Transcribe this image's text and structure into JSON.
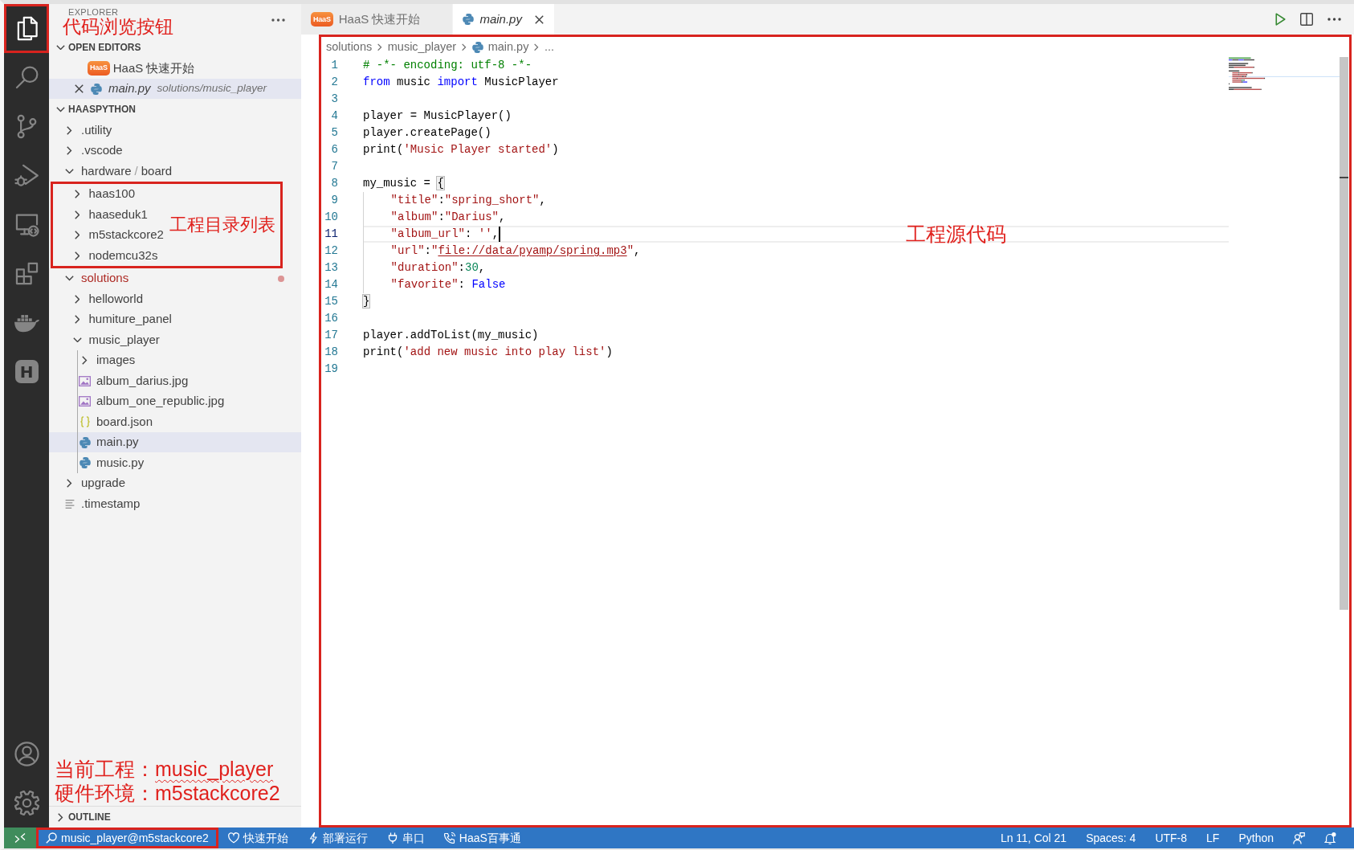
{
  "activity_bar": {
    "items": [
      {
        "kind": "explorer",
        "selected": true,
        "outlined": true
      },
      {
        "kind": "search",
        "selected": false,
        "outlined": false
      },
      {
        "kind": "source_control",
        "selected": false,
        "outlined": false
      },
      {
        "kind": "run_debug",
        "selected": false,
        "outlined": false
      },
      {
        "kind": "remote_explorer",
        "selected": false,
        "outlined": false
      },
      {
        "kind": "extensions",
        "selected": false,
        "outlined": false
      },
      {
        "kind": "docker",
        "selected": false,
        "outlined": false
      },
      {
        "kind": "haas",
        "glyph": "H",
        "selected": false,
        "outlined": false
      }
    ],
    "bottom_items": [
      {
        "kind": "accounts"
      },
      {
        "kind": "settings"
      }
    ]
  },
  "sidebar": {
    "title": "EXPLORER",
    "annotation": "代码浏览按钮",
    "actions": [
      {
        "kind": "more"
      }
    ],
    "sections": [
      {
        "kind": "open_editors",
        "title": "OPEN EDITORS",
        "expanded": true,
        "items": [
          {
            "kind": "webview",
            "logo_text": "HaaS",
            "label": "HaaS 快速开始",
            "preview": false,
            "selected": false
          },
          {
            "kind": "python",
            "label": "main.py",
            "description": "solutions/music_player",
            "preview": true,
            "selected": true
          }
        ]
      },
      {
        "kind": "workspace",
        "title": "HAASPYTHON",
        "expanded": true,
        "tree": [
          {
            "kind": "folder",
            "label": ".utility",
            "expanded": false,
            "selected": false,
            "problem": false
          },
          {
            "kind": "folder",
            "label": ".vscode",
            "expanded": false,
            "selected": false,
            "problem": false
          },
          {
            "kind": "folder",
            "segments": [
              "hardware",
              "board"
            ],
            "separator": "/",
            "expanded": true,
            "selected": false,
            "problem": false,
            "children_outlined": true,
            "annotation": "工程目录列表",
            "children": [
              {
                "kind": "folder",
                "label": "haas100",
                "expanded": false,
                "selected": false,
                "problem": false
              },
              {
                "kind": "folder",
                "label": "haaseduk1",
                "expanded": false,
                "selected": false,
                "problem": false
              },
              {
                "kind": "folder",
                "label": "m5stackcore2",
                "expanded": false,
                "selected": false,
                "problem": false
              },
              {
                "kind": "folder",
                "label": "nodemcu32s",
                "expanded": false,
                "selected": false,
                "problem": false
              }
            ]
          },
          {
            "kind": "folder",
            "label": "solutions",
            "expanded": true,
            "selected": false,
            "problem": true,
            "children_outlined": false,
            "children": [
              {
                "kind": "folder",
                "label": "helloworld",
                "expanded": false,
                "selected": false,
                "problem": false
              },
              {
                "kind": "folder",
                "label": "humiture_panel",
                "expanded": false,
                "selected": false,
                "problem": false
              },
              {
                "kind": "folder",
                "label": "music_player",
                "expanded": true,
                "selected": false,
                "problem": false,
                "children_outlined": false,
                "children": [
                  {
                    "kind": "folder",
                    "label": "images",
                    "expanded": false,
                    "selected": false,
                    "problem": false
                  },
                  {
                    "kind": "image",
                    "label": "album_darius.jpg",
                    "selected": false,
                    "problem": false
                  },
                  {
                    "kind": "image",
                    "label": "album_one_republic.jpg",
                    "selected": false,
                    "problem": false
                  },
                  {
                    "kind": "json",
                    "label": "board.json",
                    "selected": false,
                    "problem": false
                  },
                  {
                    "kind": "python",
                    "label": "main.py",
                    "selected": true,
                    "problem": false
                  },
                  {
                    "kind": "python",
                    "label": "music.py",
                    "selected": false,
                    "problem": false
                  }
                ]
              }
            ]
          },
          {
            "kind": "folder",
            "label": "upgrade",
            "expanded": false,
            "selected": false,
            "problem": false
          },
          {
            "kind": "text",
            "label": ".timestamp",
            "selected": false,
            "problem": false
          }
        ]
      }
    ],
    "notes": [
      {
        "label": "当前工程：",
        "value": "music_player",
        "squiggle": true
      },
      {
        "label": "硬件环境：",
        "value": "m5stackcore2",
        "squiggle": false
      }
    ],
    "bottom_sections": [
      {
        "kind": "outline",
        "title": "OUTLINE",
        "expanded": false
      }
    ]
  },
  "tabs": [
    {
      "kind": "webview",
      "logo_text": "HaaS",
      "label": "HaaS 快速开始",
      "preview": false,
      "selected": false
    },
    {
      "kind": "python",
      "label": "main.py",
      "preview": true,
      "selected": true
    }
  ],
  "editor_actions": [
    {
      "kind": "run"
    },
    {
      "kind": "split"
    },
    {
      "kind": "more"
    }
  ],
  "editor": {
    "outlined": true,
    "annotation": "工程源代码",
    "breadcrumbs": [
      {
        "kind": "folder",
        "label": "solutions"
      },
      {
        "kind": "folder",
        "label": "music_player"
      },
      {
        "kind": "python",
        "label": "main.py"
      },
      {
        "kind": "symbol",
        "label": "..."
      }
    ],
    "lines": [
      {
        "number": "1",
        "current": false,
        "indented": false,
        "tokens": [
          {
            "kind": "comment",
            "text": "# -*- encoding: utf-8 -*-"
          }
        ]
      },
      {
        "number": "2",
        "current": false,
        "indented": false,
        "tokens": [
          {
            "kind": "keyword",
            "text": "from"
          },
          {
            "kind": "plain",
            "text": " music "
          },
          {
            "kind": "keyword",
            "text": "import"
          },
          {
            "kind": "plain",
            "text": " MusicPlayer"
          }
        ]
      },
      {
        "number": "3",
        "current": false,
        "indented": false
      },
      {
        "number": "4",
        "current": false,
        "indented": false,
        "tokens": [
          {
            "kind": "plain",
            "text": "player = MusicPlayer()"
          }
        ]
      },
      {
        "number": "5",
        "current": false,
        "indented": false,
        "tokens": [
          {
            "kind": "plain",
            "text": "player.createPage()"
          }
        ]
      },
      {
        "number": "6",
        "current": false,
        "indented": false,
        "tokens": [
          {
            "kind": "plain",
            "text": "print("
          },
          {
            "kind": "string",
            "text": "'Music Player started'"
          },
          {
            "kind": "plain",
            "text": ")"
          }
        ]
      },
      {
        "number": "7",
        "current": false,
        "indented": false
      },
      {
        "number": "8",
        "current": false,
        "indented": false,
        "tokens": [
          {
            "kind": "plain",
            "text": "my_music = "
          },
          {
            "kind": "bracket",
            "text": "{"
          }
        ]
      },
      {
        "number": "9",
        "current": false,
        "indented": true,
        "tokens": [
          {
            "kind": "string",
            "text": "\"title\""
          },
          {
            "kind": "plain",
            "text": ":"
          },
          {
            "kind": "string",
            "text": "\"spring_short\""
          },
          {
            "kind": "plain",
            "text": ","
          }
        ]
      },
      {
        "number": "10",
        "current": false,
        "indented": true,
        "tokens": [
          {
            "kind": "string",
            "text": "\"album\""
          },
          {
            "kind": "plain",
            "text": ":"
          },
          {
            "kind": "string",
            "text": "\"Darius\""
          },
          {
            "kind": "plain",
            "text": ","
          }
        ]
      },
      {
        "number": "11",
        "current": true,
        "indented": true,
        "tokens": [
          {
            "kind": "string",
            "text": "\"album_url\""
          },
          {
            "kind": "plain",
            "text": ": "
          },
          {
            "kind": "string",
            "text": "''"
          },
          {
            "kind": "plain",
            "text": ","
          }
        ]
      },
      {
        "number": "12",
        "current": false,
        "indented": true,
        "tokens": [
          {
            "kind": "string",
            "text": "\"url\""
          },
          {
            "kind": "plain",
            "text": ":"
          },
          {
            "kind": "string",
            "text": "\""
          },
          {
            "kind": "link",
            "text": "file://data/pyamp/spring.mp3"
          },
          {
            "kind": "string",
            "text": "\""
          },
          {
            "kind": "plain",
            "text": ","
          }
        ]
      },
      {
        "number": "13",
        "current": false,
        "indented": true,
        "tokens": [
          {
            "kind": "string",
            "text": "\"duration\""
          },
          {
            "kind": "plain",
            "text": ":"
          },
          {
            "kind": "number",
            "text": "30"
          },
          {
            "kind": "plain",
            "text": ","
          }
        ]
      },
      {
        "number": "14",
        "current": false,
        "indented": true,
        "tokens": [
          {
            "kind": "string",
            "text": "\"favorite\""
          },
          {
            "kind": "plain",
            "text": ": "
          },
          {
            "kind": "keyword",
            "text": "False"
          }
        ]
      },
      {
        "number": "15",
        "current": false,
        "indented": false,
        "tokens": [
          {
            "kind": "bracket",
            "text": "}"
          }
        ]
      },
      {
        "number": "16",
        "current": false,
        "indented": false
      },
      {
        "number": "17",
        "current": false,
        "indented": false,
        "tokens": [
          {
            "kind": "plain",
            "text": "player.addToList(my_music)"
          }
        ]
      },
      {
        "number": "18",
        "current": false,
        "indented": false,
        "tokens": [
          {
            "kind": "plain",
            "text": "print("
          },
          {
            "kind": "string",
            "text": "'add new music into play list'"
          },
          {
            "kind": "plain",
            "text": ")"
          }
        ]
      },
      {
        "number": "19",
        "current": false,
        "indented": false
      }
    ]
  },
  "status_bar": {
    "left": [
      {
        "kind": "remote",
        "outlined": false
      },
      {
        "kind": "project",
        "label": "music_player@m5stackcore2",
        "outlined": true
      },
      {
        "kind": "quickstart",
        "label": "快速开始",
        "outlined": false
      },
      {
        "kind": "deploy",
        "label": "部署运行",
        "outlined": false
      },
      {
        "kind": "serial",
        "label": "串口",
        "outlined": false
      },
      {
        "kind": "assistant",
        "label": "HaaS百事通",
        "outlined": false
      }
    ],
    "right": [
      {
        "kind": "text",
        "label": "Ln 11, Col 21"
      },
      {
        "kind": "text",
        "label": "Spaces: 4"
      },
      {
        "kind": "text",
        "label": "UTF-8"
      },
      {
        "kind": "text",
        "label": "LF"
      },
      {
        "kind": "text",
        "label": "Python"
      },
      {
        "kind": "feedback"
      },
      {
        "kind": "notifications",
        "unread": true
      }
    ]
  }
}
